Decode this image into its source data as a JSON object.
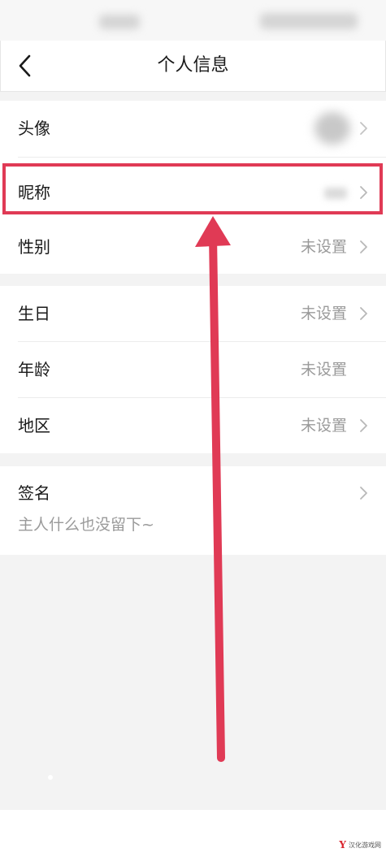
{
  "header": {
    "title": "个人信息",
    "back_icon": "chevron-left-icon"
  },
  "profile": {
    "avatar_label": "头像",
    "nickname_label": "昵称",
    "gender": {
      "label": "性别",
      "value": "未设置"
    },
    "birthday": {
      "label": "生日",
      "value": "未设置"
    },
    "age": {
      "label": "年龄",
      "value": "未设置"
    },
    "region": {
      "label": "地区",
      "value": "未设置"
    },
    "signature": {
      "label": "签名",
      "value": "主人什么也没留下~"
    }
  },
  "annotation": {
    "highlight_color": "#e03a55"
  },
  "watermark": {
    "logo": "Y",
    "text": "汉化游戏网"
  }
}
